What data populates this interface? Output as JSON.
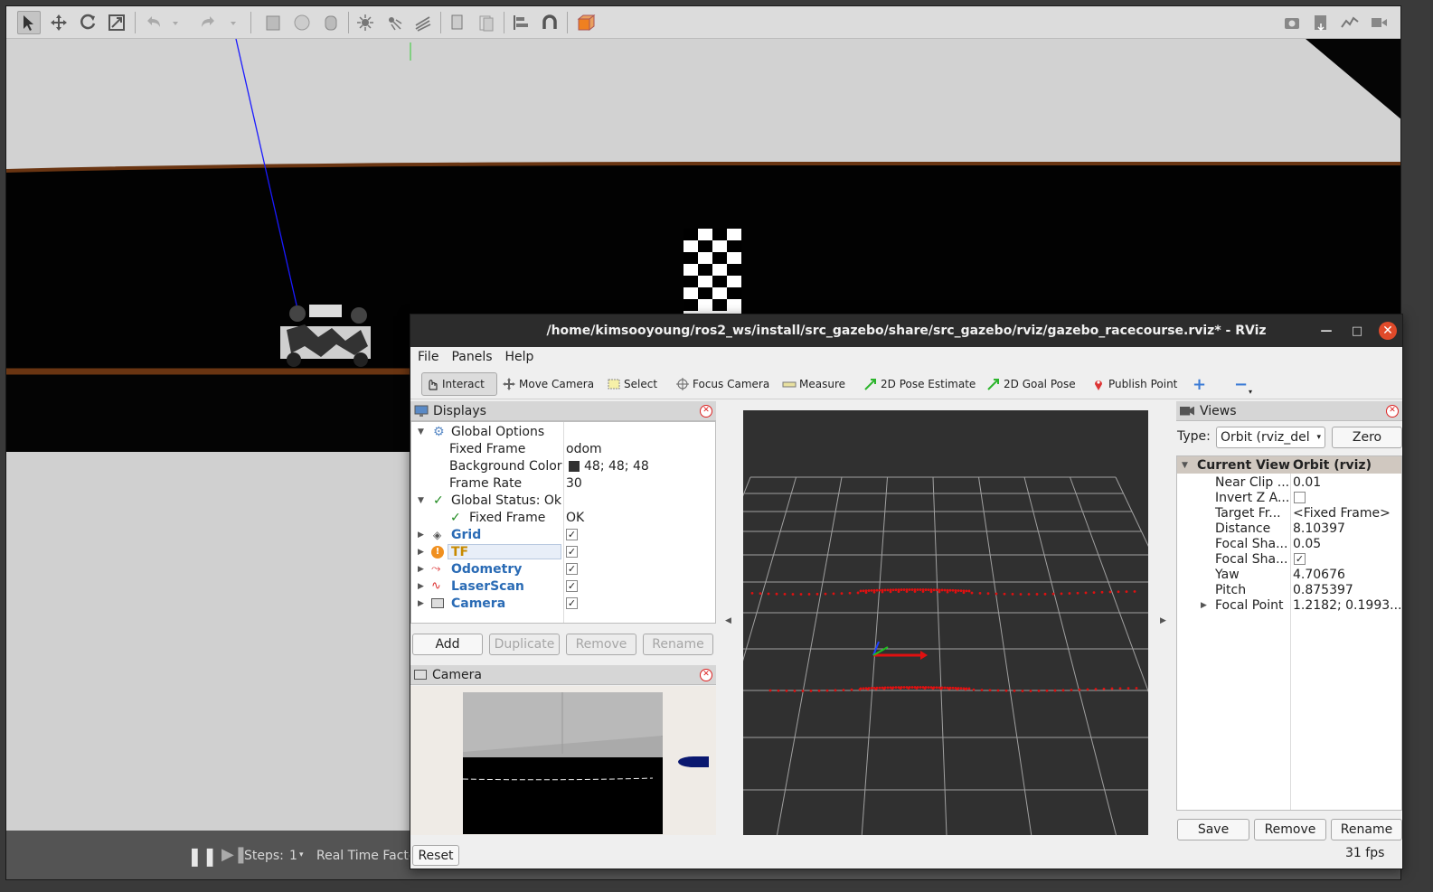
{
  "gazebo": {
    "toolbar_icons": [
      "select-arrow-icon",
      "translate-icon",
      "rotate-icon",
      "scale-icon",
      "undo-icon",
      "undo-dropdown-icon",
      "redo-icon",
      "redo-dropdown-icon",
      "box-icon",
      "sphere-icon",
      "cylinder-icon",
      "point-light-icon",
      "spot-light-icon",
      "directional-light-icon",
      "copy-icon",
      "paste-icon",
      "align-icon",
      "snap-icon",
      "view-angle-icon",
      "screenshot-icon",
      "log-icon",
      "plot-icon",
      "record-video-icon"
    ],
    "status": {
      "steps_label": "Steps:",
      "steps_value": "1",
      "real_time_factor_label": "Real Time Facto"
    }
  },
  "rviz": {
    "title": "/home/kimsooyoung/ros2_ws/install/src_gazebo/share/src_gazebo/rviz/gazebo_racecourse.rviz* - RViz",
    "menu": [
      "File",
      "Panels",
      "Help"
    ],
    "tools": [
      {
        "label": "Interact",
        "icon": "hand-icon"
      },
      {
        "label": "Move Camera",
        "icon": "move-camera-icon"
      },
      {
        "label": "Select",
        "icon": "select-icon"
      },
      {
        "label": "Focus Camera",
        "icon": "focus-camera-icon"
      },
      {
        "label": "Measure",
        "icon": "ruler-icon"
      },
      {
        "label": "2D Pose Estimate",
        "icon": "green-arrow-icon"
      },
      {
        "label": "2D Goal Pose",
        "icon": "green-arrow-icon"
      },
      {
        "label": "Publish Point",
        "icon": "map-pin-icon"
      }
    ],
    "displays": {
      "title": "Displays",
      "global_options": "Global Options",
      "fixed_frame_label": "Fixed Frame",
      "fixed_frame_value": "odom",
      "bg_color_label": "Background Color",
      "bg_color_value": "48; 48; 48",
      "frame_rate_label": "Frame Rate",
      "frame_rate_value": "30",
      "global_status": "Global Status: Ok",
      "status_fixed_frame": "Fixed Frame",
      "status_fixed_frame_value": "OK",
      "items": [
        {
          "name": "Grid",
          "checked": true
        },
        {
          "name": "TF",
          "checked": true
        },
        {
          "name": "Odometry",
          "checked": true
        },
        {
          "name": "LaserScan",
          "checked": true
        },
        {
          "name": "Camera",
          "checked": true
        }
      ],
      "buttons": {
        "add": "Add",
        "duplicate": "Duplicate",
        "remove": "Remove",
        "rename": "Rename"
      }
    },
    "camera_panel": {
      "title": "Camera"
    },
    "views": {
      "title": "Views",
      "type_label": "Type:",
      "type_value": "Orbit (rviz_del",
      "zero": "Zero",
      "current_view": "Current View",
      "current_view_value": "Orbit (rviz)",
      "props": [
        {
          "k": "Near Clip ...",
          "v": "0.01"
        },
        {
          "k": "Invert Z A...",
          "v": "",
          "checkbox": true,
          "checked": false
        },
        {
          "k": "Target Fr...",
          "v": "<Fixed Frame>"
        },
        {
          "k": "Distance",
          "v": "8.10397"
        },
        {
          "k": "Focal Sha...",
          "v": "0.05"
        },
        {
          "k": "Focal Sha...",
          "v": "",
          "checkbox": true,
          "checked": true
        },
        {
          "k": "Yaw",
          "v": "4.70676"
        },
        {
          "k": "Pitch",
          "v": "0.875397"
        },
        {
          "k": "Focal Point",
          "v": "1.2182; 0.1993...",
          "expandable": true
        }
      ],
      "buttons": {
        "save": "Save",
        "remove": "Remove",
        "rename": "Rename"
      }
    },
    "reset": "Reset",
    "fps": "31 fps"
  },
  "colors": {
    "bg_color_swatch": "#303030",
    "display_name": "#2a6bb5",
    "tf_name": "#c88a00",
    "laser_points": "#e01010",
    "close_button": "#e04a2a"
  }
}
